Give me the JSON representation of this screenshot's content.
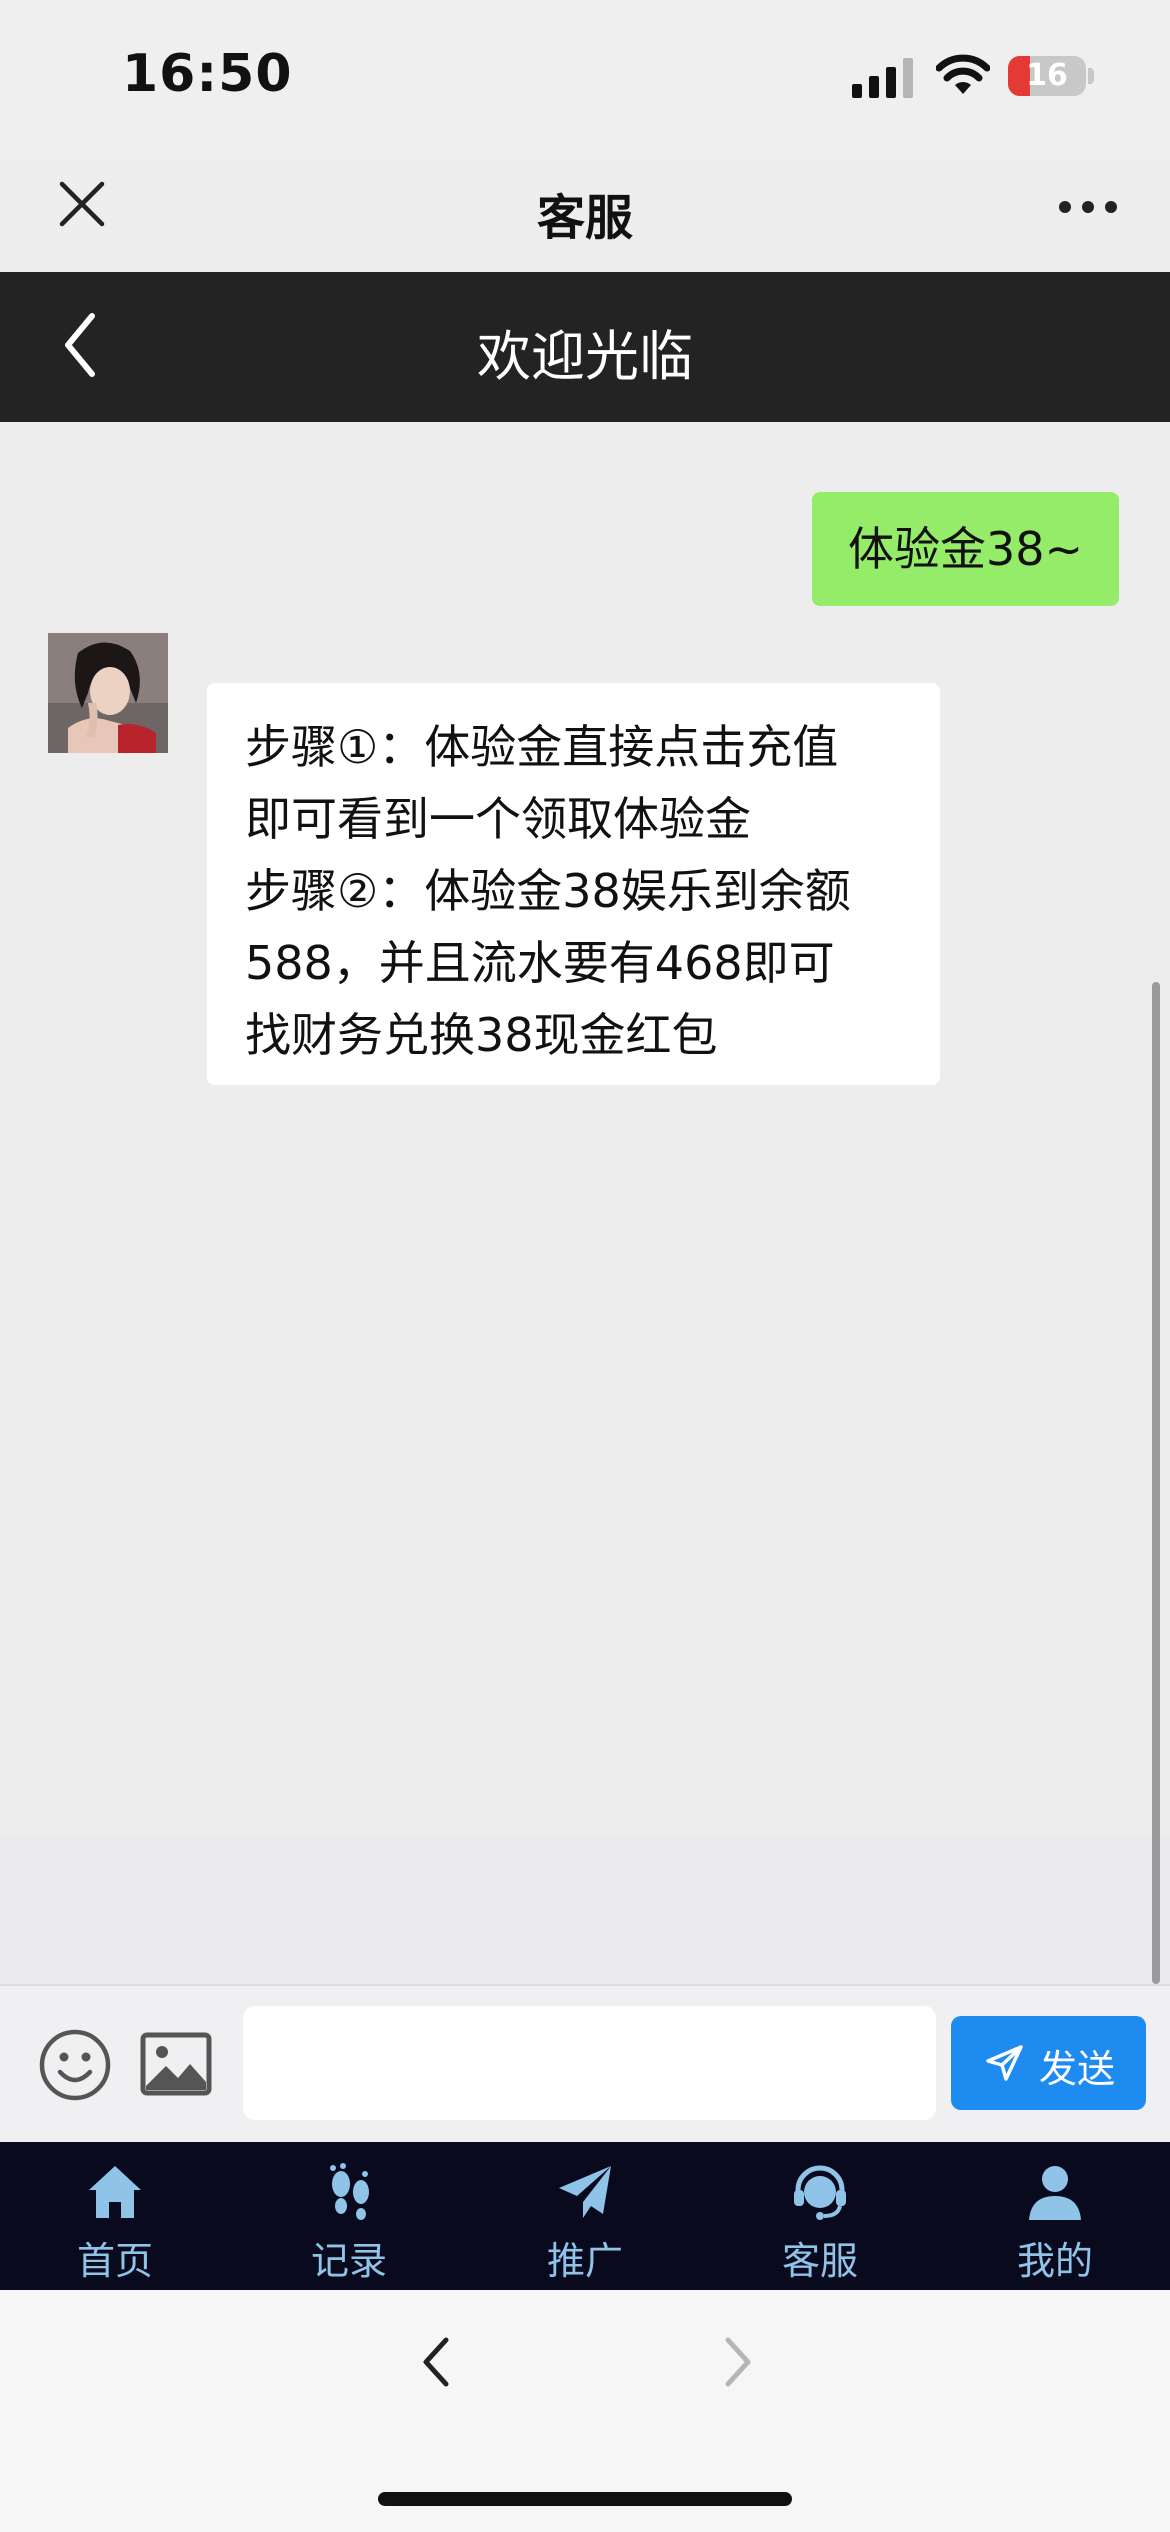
{
  "status_bar": {
    "time": "16:50",
    "battery": "16"
  },
  "nav": {
    "title": "客服"
  },
  "header": {
    "title": "欢迎光临"
  },
  "chat": {
    "messages": [
      {
        "from": "me",
        "text": "体验金38~"
      },
      {
        "from": "agent",
        "lines": [
          "步骤①：体验金直接点击充值",
          "即可看到一个领取体验金",
          "步骤②：体验金38娱乐到余额",
          "588，并且流水要有468即可",
          "找财务兑换38现金红包"
        ]
      }
    ]
  },
  "input": {
    "value": "",
    "placeholder": "",
    "send_label": "发送"
  },
  "tabs": [
    {
      "label": "首页",
      "icon": "home-icon"
    },
    {
      "label": "记录",
      "icon": "footprint-icon"
    },
    {
      "label": "推广",
      "icon": "paper-plane-icon"
    },
    {
      "label": "客服",
      "icon": "headset-icon"
    },
    {
      "label": "我的",
      "icon": "user-icon"
    }
  ],
  "colors": {
    "dark_header": "#232323",
    "outgoing_bubble": "#95ec69",
    "send_button": "#1d8bf0",
    "tabbar": "#0a0a1f",
    "tab_label": "#8fc3e8"
  }
}
